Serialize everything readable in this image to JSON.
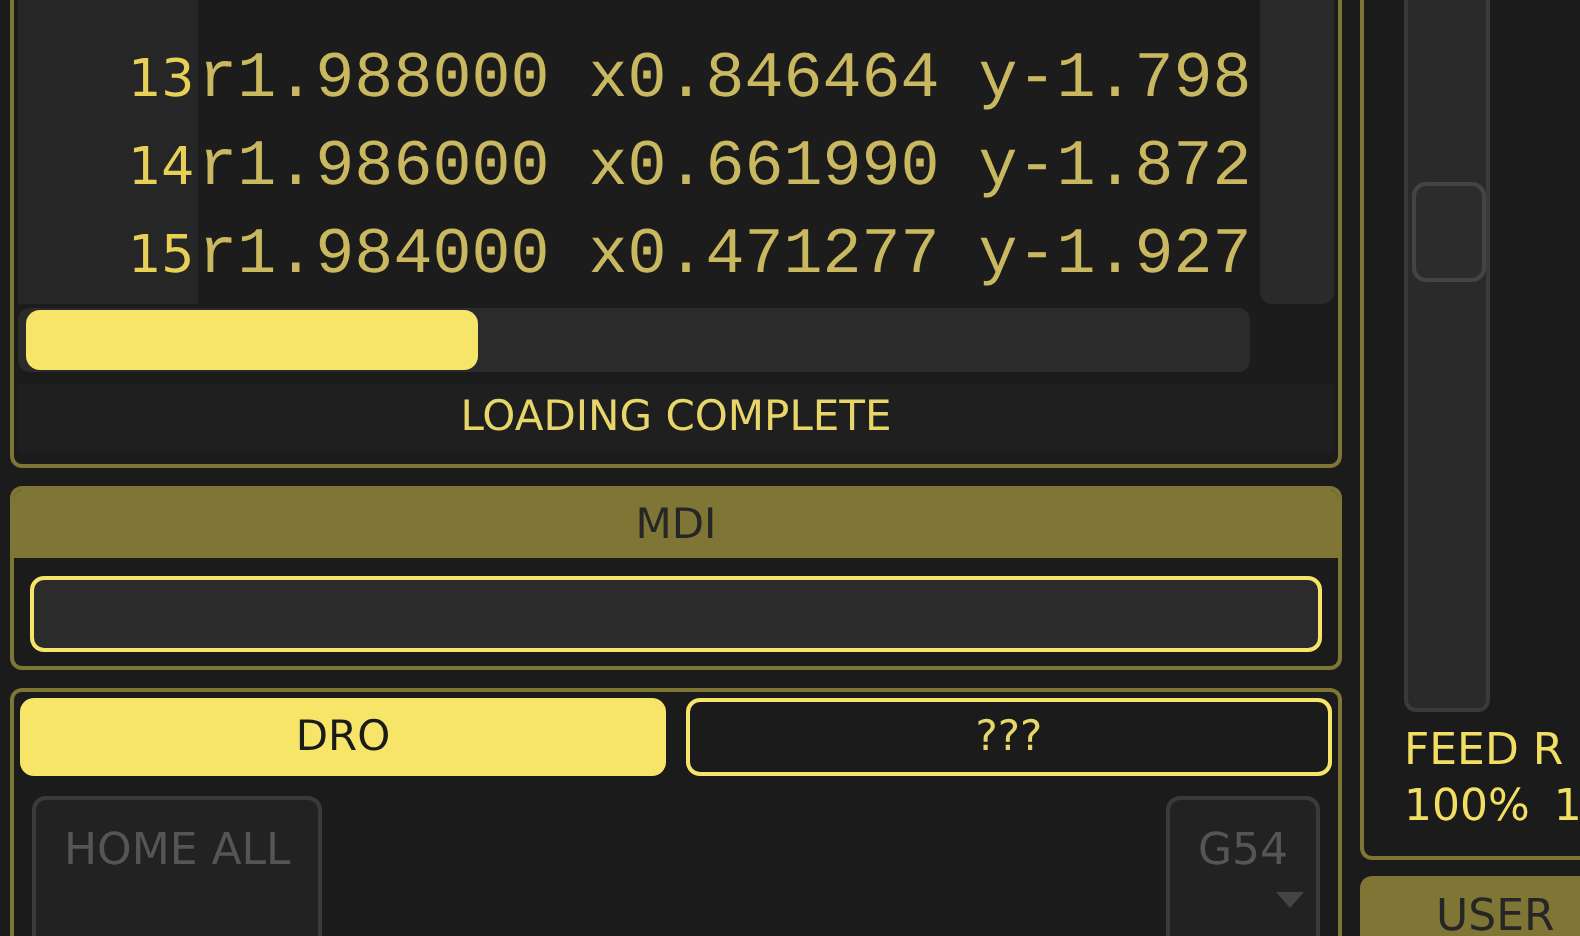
{
  "code_view": {
    "lines": [
      {
        "number": "13",
        "text": "r1.988000 x0.846464 y-1.798"
      },
      {
        "number": "14",
        "text": "r1.986000 x0.661990 y-1.872"
      },
      {
        "number": "15",
        "text": "r1.984000 x0.471277 y-1.927"
      }
    ]
  },
  "status": "LOADING COMPLETE",
  "mdi": {
    "title": "MDI"
  },
  "dro_panel": {
    "tabs": [
      {
        "label": "DRO",
        "selected": true
      },
      {
        "label": "???",
        "selected": false
      }
    ],
    "buttons": [
      {
        "label": "HOME ALL",
        "kind": "button",
        "disabled": true
      },
      {
        "label": "G54",
        "kind": "dropdown",
        "disabled": true
      }
    ]
  },
  "feed_panel": {
    "slider": {
      "level": 0.7
    },
    "label": "FEED R",
    "readings": [
      "100%",
      "1"
    ]
  },
  "user_panel": {
    "title": "USER"
  }
}
